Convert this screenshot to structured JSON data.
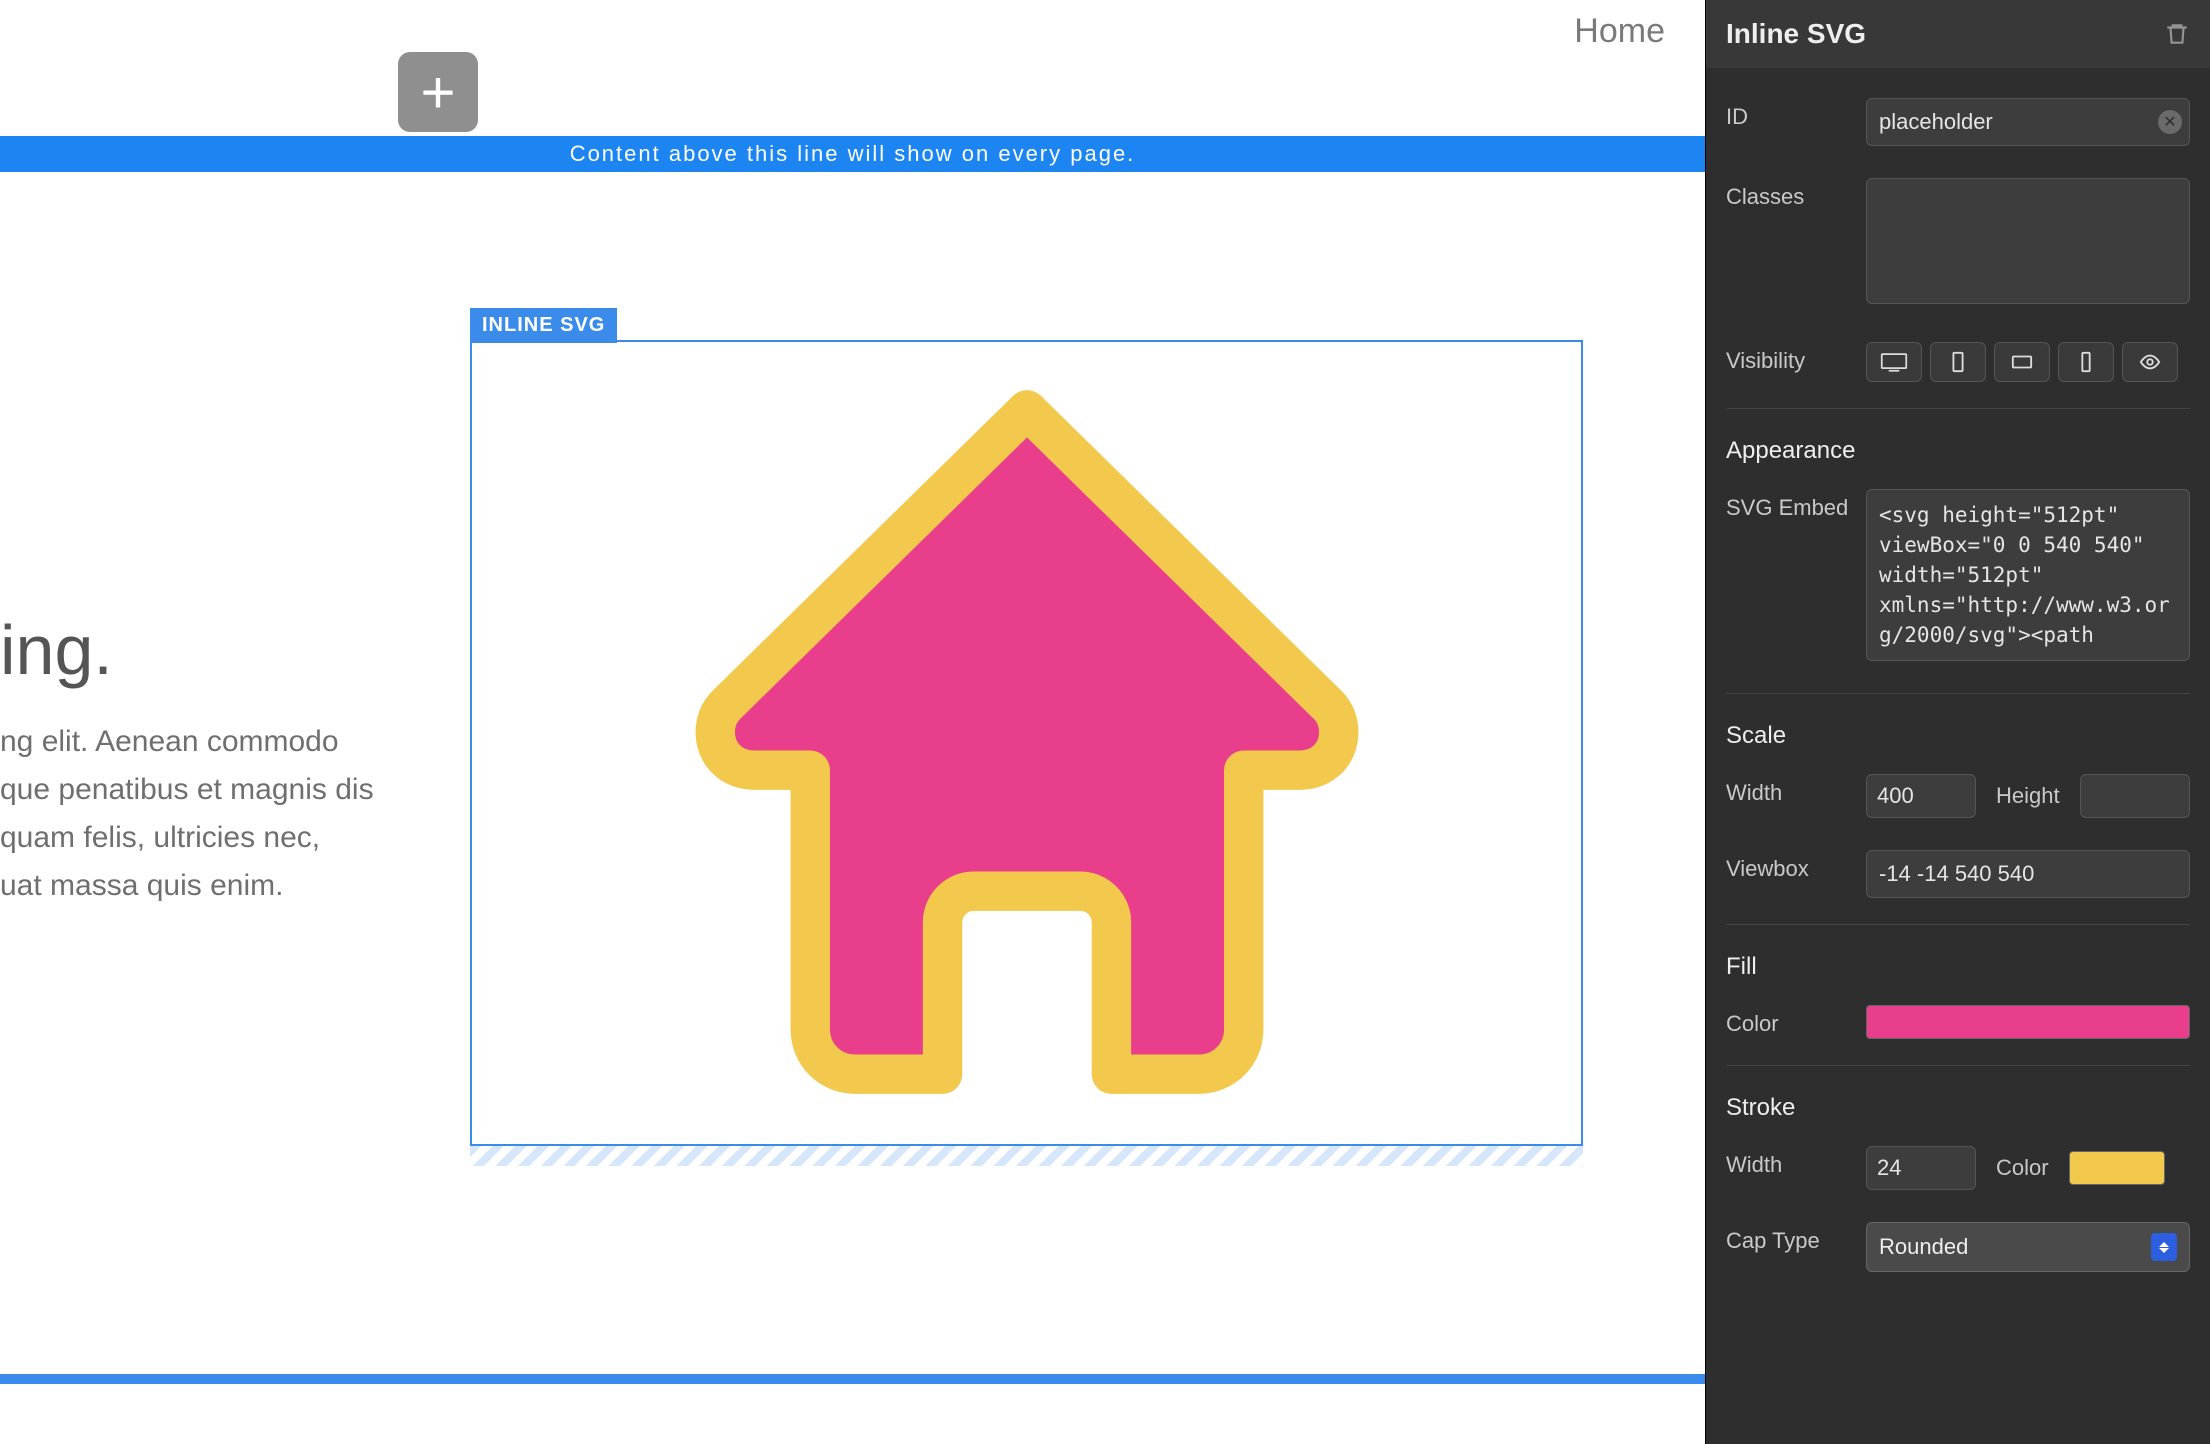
{
  "nav": {
    "home": "Home"
  },
  "template_bar": "Content above this line will show on every page.",
  "selected_tag": "INLINE SVG",
  "heading_fragment": "ing.",
  "body_fragment": "ng elit. Aenean commodo\nque penatibus et magnis dis\nquam felis, ultricies nec,\nuat massa quis enim.",
  "inspector": {
    "title": "Inline SVG",
    "id_label": "ID",
    "id_value": "placeholder",
    "classes_label": "Classes",
    "classes_value": "",
    "visibility_label": "Visibility",
    "appearance": {
      "title": "Appearance",
      "svg_embed_label": "SVG Embed",
      "svg_embed_value": "<svg height=\"512pt\" viewBox=\"0 0 540 540\" width=\"512pt\" xmlns=\"http://www.w3.org/2000/svg\"><path"
    },
    "scale": {
      "title": "Scale",
      "width_label": "Width",
      "width_value": "400",
      "height_label": "Height",
      "height_value": "",
      "viewbox_label": "Viewbox",
      "viewbox_value": "-14 -14 540 540"
    },
    "fill": {
      "title": "Fill",
      "color_label": "Color",
      "color_value": "#e83e8c"
    },
    "stroke": {
      "title": "Stroke",
      "width_label": "Width",
      "width_value": "24",
      "color_label": "Color",
      "color_value": "#f2c94c",
      "cap_label": "Cap Type",
      "cap_value": "Rounded"
    }
  }
}
